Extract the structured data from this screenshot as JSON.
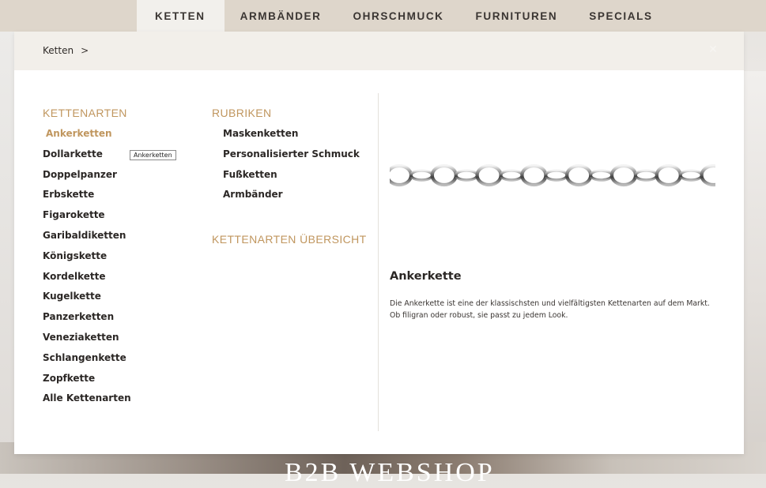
{
  "nav": {
    "items": [
      {
        "label": "KETTEN",
        "active": true
      },
      {
        "label": "ARMBÄNDER",
        "active": false
      },
      {
        "label": "OHRSCHMUCK",
        "active": false
      },
      {
        "label": "FURNITUREN",
        "active": false
      },
      {
        "label": "SPECIALS",
        "active": false
      }
    ]
  },
  "breadcrumb": {
    "label": "Ketten",
    "separator": ">"
  },
  "close_icon": "close-icon",
  "kettenarten": {
    "heading": "KETTENARTEN",
    "items": [
      "Ankerketten",
      "Dollarkette",
      "Doppelpanzer",
      "Erbskette",
      "Figarokette",
      "Garibaldiketten",
      "Königskette",
      "Kordelkette",
      "Kugelkette",
      "Panzerketten",
      "Veneziaketten",
      "Schlangenkette",
      "Zopfkette",
      "Alle Kettenarten"
    ],
    "active_index": 0
  },
  "tooltip": {
    "text": "Ankerketten"
  },
  "rubriken": {
    "heading": "RUBRIKEN",
    "items": [
      "Maskenketten",
      "Personalisierter Schmuck",
      "Fußketten",
      "Armbänder"
    ]
  },
  "overview": {
    "label": "KETTENARTEN ÜBERSICHT"
  },
  "preview": {
    "image": "anchor-chain-image",
    "title": "Ankerkette",
    "description": "Die Ankerkette ist eine der klassischsten und vielfältigsten Kettenarten auf dem Markt. Ob filigran oder robust, sie passt zu jedem Look."
  },
  "background": {
    "hero_text": "B2B WEBSHOP"
  },
  "colors": {
    "accent": "#c0965e",
    "nav_bg": "#ded6cb",
    "crumb_bg": "#f2efea",
    "text": "#2b2725"
  }
}
